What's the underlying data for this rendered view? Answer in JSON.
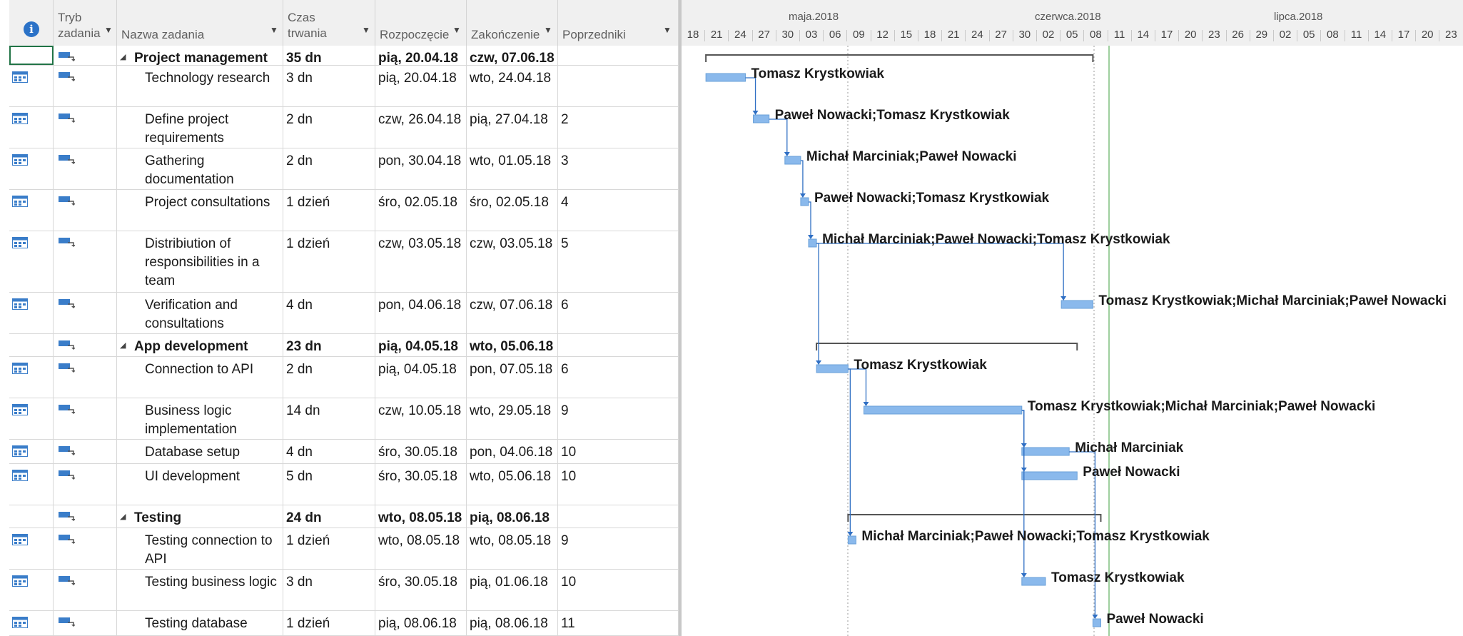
{
  "headers": {
    "info_icon": "info-icon",
    "mode_line1": "Tryb",
    "mode_line2": "zadania",
    "name": "Nazwa zadania",
    "duration_line1": "Czas",
    "duration_line2": "trwania",
    "start": "Rozpoczęcie",
    "finish": "Zakończenie",
    "predecessors": "Poprzedniki"
  },
  "timescale": {
    "months": [
      "maja.2018",
      "czerwca.2018",
      "lipca.2018"
    ],
    "days": [
      "18",
      "21",
      "24",
      "27",
      "30",
      "03",
      "06",
      "09",
      "12",
      "15",
      "18",
      "21",
      "24",
      "27",
      "30",
      "02",
      "05",
      "08",
      "11",
      "14",
      "17",
      "20",
      "23",
      "26",
      "29",
      "02",
      "05",
      "08",
      "11",
      "14",
      "17",
      "20",
      "23"
    ]
  },
  "tasks": [
    {
      "id": "1",
      "summary": true,
      "name": "Project management",
      "duration": "35 dn",
      "start": "pią, 20.04.18",
      "finish": "czw, 07.06.18",
      "pred": "",
      "resources": ""
    },
    {
      "id": "2",
      "summary": false,
      "name": "Technology research",
      "duration": "3 dn",
      "start": "pią, 20.04.18",
      "finish": "wto, 24.04.18",
      "pred": "",
      "resources": "Tomasz Krystkowiak"
    },
    {
      "id": "3",
      "summary": false,
      "name": "Define project requirements",
      "duration": "2 dn",
      "start": "czw, 26.04.18",
      "finish": "pią, 27.04.18",
      "pred": "2",
      "resources": "Paweł Nowacki;Tomasz Krystkowiak"
    },
    {
      "id": "4",
      "summary": false,
      "name": "Gathering documentation",
      "duration": "2 dn",
      "start": "pon, 30.04.18",
      "finish": "wto, 01.05.18",
      "pred": "3",
      "resources": "Michał Marciniak;Paweł Nowacki"
    },
    {
      "id": "5",
      "summary": false,
      "name": "Project consultations",
      "duration": "1 dzień",
      "start": "śro, 02.05.18",
      "finish": "śro, 02.05.18",
      "pred": "4",
      "resources": "Paweł Nowacki;Tomasz Krystkowiak"
    },
    {
      "id": "6",
      "summary": false,
      "name": "Distribiution of responsibilities in a team",
      "duration": "1 dzień",
      "start": "czw, 03.05.18",
      "finish": "czw, 03.05.18",
      "pred": "5",
      "resources": "Michał Marciniak;Paweł Nowacki;Tomasz Krystkowiak"
    },
    {
      "id": "7",
      "summary": false,
      "name": "Verification and consultations",
      "duration": "4 dn",
      "start": "pon, 04.06.18",
      "finish": "czw, 07.06.18",
      "pred": "6",
      "resources": "Tomasz Krystkowiak;Michał Marciniak;Paweł Nowacki"
    },
    {
      "id": "8",
      "summary": true,
      "name": "App development",
      "duration": "23 dn",
      "start": "pią, 04.05.18",
      "finish": "wto, 05.06.18",
      "pred": "",
      "resources": ""
    },
    {
      "id": "9",
      "summary": false,
      "name": "Connection to API",
      "duration": "2 dn",
      "start": "pią, 04.05.18",
      "finish": "pon, 07.05.18",
      "pred": "6",
      "resources": "Tomasz Krystkowiak"
    },
    {
      "id": "10",
      "summary": false,
      "name": "Business logic implementation",
      "duration": "14 dn",
      "start": "czw, 10.05.18",
      "finish": "wto, 29.05.18",
      "pred": "9",
      "resources": "Tomasz Krystkowiak;Michał Marciniak;Paweł Nowacki"
    },
    {
      "id": "11",
      "summary": false,
      "name": "Database setup",
      "duration": "4 dn",
      "start": "śro, 30.05.18",
      "finish": "pon, 04.06.18",
      "pred": "10",
      "resources": "Michał Marciniak"
    },
    {
      "id": "12",
      "summary": false,
      "name": "UI development",
      "duration": "5 dn",
      "start": "śro, 30.05.18",
      "finish": "wto, 05.06.18",
      "pred": "10",
      "resources": "Paweł Nowacki"
    },
    {
      "id": "13",
      "summary": true,
      "name": "Testing",
      "duration": "24 dn",
      "start": "wto, 08.05.18",
      "finish": "pią, 08.06.18",
      "pred": "",
      "resources": ""
    },
    {
      "id": "14",
      "summary": false,
      "name": "Testing connection to API",
      "duration": "1 dzień",
      "start": "wto, 08.05.18",
      "finish": "wto, 08.05.18",
      "pred": "9",
      "resources": "Michał Marciniak;Paweł Nowacki;Tomasz Krystkowiak"
    },
    {
      "id": "15",
      "summary": false,
      "name": "Testing business logic",
      "duration": "3 dn",
      "start": "śro, 30.05.18",
      "finish": "pią, 01.06.18",
      "pred": "10",
      "resources": "Tomasz Krystkowiak"
    },
    {
      "id": "16",
      "summary": false,
      "name": "Testing database",
      "duration": "1 dzień",
      "start": "pią, 08.06.18",
      "finish": "pią, 08.06.18",
      "pred": "11",
      "resources": "Paweł Nowacki"
    }
  ],
  "colors": {
    "bar": "#8ab9ec",
    "link": "#2f6fc4",
    "summary": "#555555",
    "today_line": "#7fbf7f"
  }
}
